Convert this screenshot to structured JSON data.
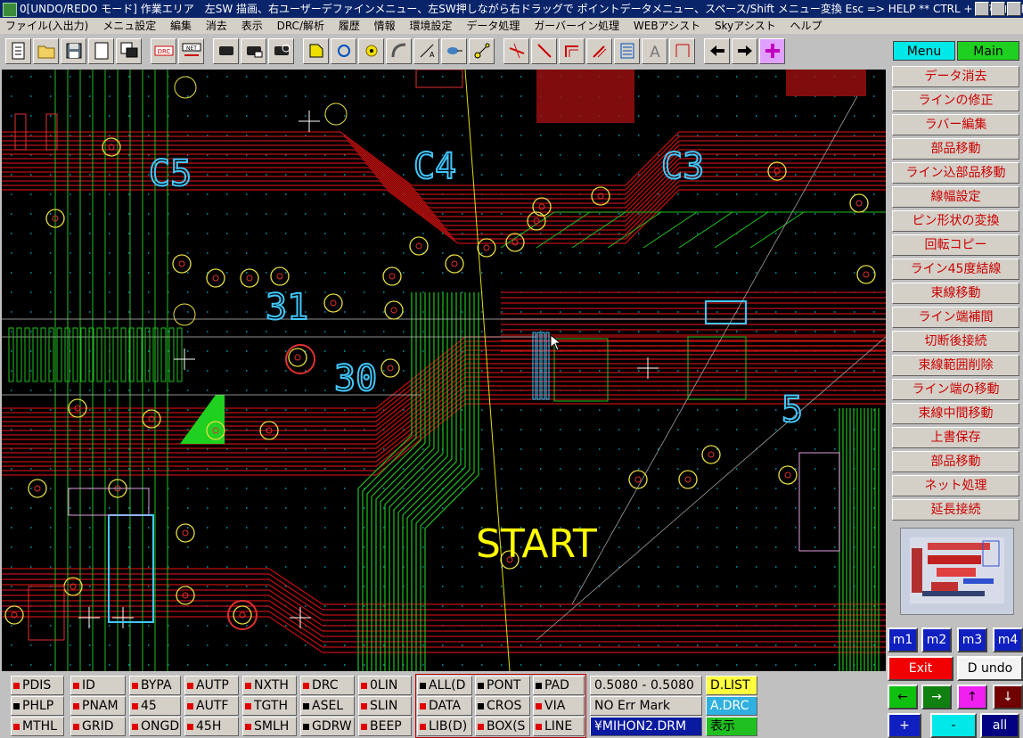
{
  "window": {
    "title": "0[UNDO/REDO モード] 作業エリア　左SW 描画、右ユーザーデファインメニュー、左SW押しながら右ドラッグで ポイントデータメニュー、スペース/Shift メニュー変換 Esc => HELP  ** CTRL + h でコントロールキー コマンド"
  },
  "menubar": {
    "items": [
      "ファイル(入出力)",
      "メニュ設定",
      "編集",
      "消去",
      "表示",
      "DRC/解析",
      "履歴",
      "情報",
      "環境設定",
      "データ処理",
      "ガーバーイン処理",
      "WEBアシスト",
      "Skyアシスト",
      "ヘルプ"
    ]
  },
  "toolbar": {
    "buttons": [
      "new-doc",
      "open-folder",
      "save-disk",
      "blank-page",
      "chip-copy",
      "drc",
      "net",
      "chip-1",
      "chip-2",
      "chip-3",
      "pad-shape",
      "circle",
      "yellow-dot",
      "arc",
      "slash-a",
      "probe",
      "move-node",
      "trace-cross-1",
      "trace-cross-2",
      "corner-1",
      "corner-2",
      "box-lines",
      "text-a",
      "dimension",
      "arrow-left",
      "arrow-right",
      "crosshair-add"
    ]
  },
  "canvas": {
    "start_label": "START",
    "component_labels": [
      "C5",
      "C4",
      "C3",
      "31",
      "30",
      "5"
    ]
  },
  "rightpanel": {
    "tabs": {
      "menu": "Menu",
      "main": "Main"
    },
    "buttons": [
      "データ消去",
      "ラインの修正",
      "ラバー編集",
      "部品移動",
      "ライン込部品移動",
      "線幅設定",
      "ピン形状の変換",
      "回転コピー",
      "ライン45度結線",
      "束線移動",
      "ライン端補間",
      "切断後接続",
      "束線範囲削除",
      "ライン端の移動",
      "束線中間移動",
      "上書保存",
      "部品移動",
      "ネット処理",
      "延長接続"
    ],
    "mode_buttons": [
      "m1",
      "m2",
      "m3",
      "m4"
    ],
    "exit_label": "Exit",
    "dundo_label": "D undo",
    "nav_buttons": [
      "←",
      "→",
      "↑",
      "↓"
    ],
    "plus_label": "+",
    "minus_label": "-",
    "all_label": "all"
  },
  "statusbar": {
    "col1": [
      {
        "label": "PDIS",
        "color": "#e00000"
      },
      {
        "label": "PHLP",
        "color": "#000000"
      },
      {
        "label": "MTHL",
        "color": "#e00000"
      }
    ],
    "col2": [
      {
        "label": "ID",
        "color": "#e00000"
      },
      {
        "label": "PNAM",
        "color": "#e00000"
      },
      {
        "label": "GRID",
        "color": "#e00000"
      }
    ],
    "col3": [
      {
        "label": "BYPA",
        "color": "#e00000"
      },
      {
        "label": "45",
        "color": "#e00000"
      },
      {
        "label": "ONGD",
        "color": "#e00000"
      }
    ],
    "col4": [
      {
        "label": "AUTP",
        "color": "#e00000"
      },
      {
        "label": "AUTF",
        "color": "#e00000"
      },
      {
        "label": "45H",
        "color": "#e00000"
      }
    ],
    "col5": [
      {
        "label": "NXTH",
        "color": "#e00000"
      },
      {
        "label": "TGTH",
        "color": "#e00000"
      },
      {
        "label": "SMLH",
        "color": "#e00000"
      }
    ],
    "col6": [
      {
        "label": "DRC",
        "color": "#e00000"
      },
      {
        "label": "ASEL",
        "color": "#000000"
      },
      {
        "label": "GDRW",
        "color": "#000000"
      }
    ],
    "col7": [
      {
        "label": "0LIN",
        "color": "#e00000"
      },
      {
        "label": "SLIN",
        "color": "#e00000"
      },
      {
        "label": "BEEP",
        "color": "#e00000"
      }
    ],
    "col8": [
      {
        "label": "ALL(D",
        "color": "#000000"
      },
      {
        "label": "DATA",
        "color": "#e00000"
      },
      {
        "label": "LIB(D)",
        "color": "#e00000"
      }
    ],
    "col9": [
      {
        "label": "PONT",
        "color": "#000000"
      },
      {
        "label": "CROS",
        "color": "#000000"
      },
      {
        "label": "BOX(S",
        "color": "#e00000"
      }
    ],
    "col10": [
      {
        "label": "PAD",
        "color": "#000000"
      },
      {
        "label": "VIA",
        "color": "#e00000"
      },
      {
        "label": "LINE",
        "color": "#e00000"
      }
    ],
    "coords": "0.5080 - 0.5080",
    "err_mark": "NO Err Mark",
    "file": "¥MIHON2.DRM",
    "dlist": "D.LIST",
    "adrc": "A.DRC",
    "display": "表示"
  }
}
